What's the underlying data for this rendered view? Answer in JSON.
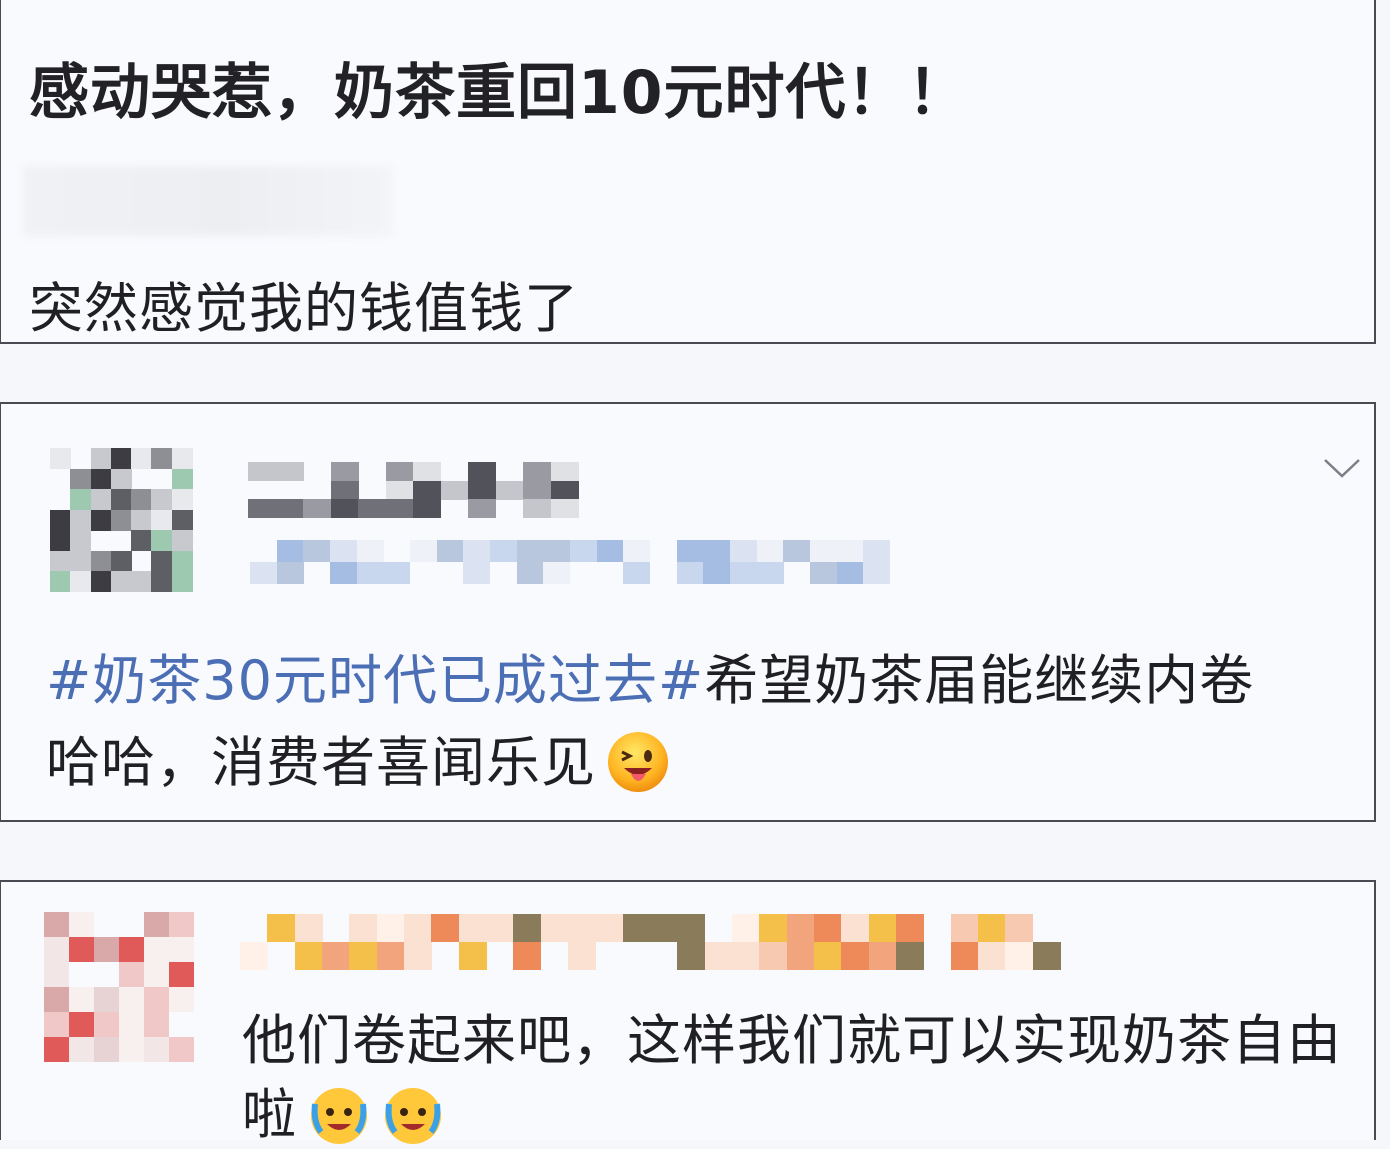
{
  "post": {
    "title": "感动哭惹，奶茶重回10元时代！！",
    "body": "突然感觉我的钱值钱了"
  },
  "comments": [
    {
      "hashtag": "#奶茶30元时代已成过去#",
      "text_line1_rest": "希望奶茶届能继续内卷",
      "text_line2": "哈哈，消费者喜闻乐见",
      "emoji": "tongue-out-wink-emoji"
    },
    {
      "text_line1": "他们卷起来吧，这样我们就可以实现奶茶自由",
      "text_line2": "啦",
      "emojis": [
        "crying-laughing-emoji",
        "crying-laughing-emoji"
      ]
    }
  ],
  "icons": {
    "more": "chevron-down-icon"
  },
  "colors": {
    "hashtag": "#4b6eb5",
    "text": "#202024",
    "border": "#4a4a52"
  }
}
